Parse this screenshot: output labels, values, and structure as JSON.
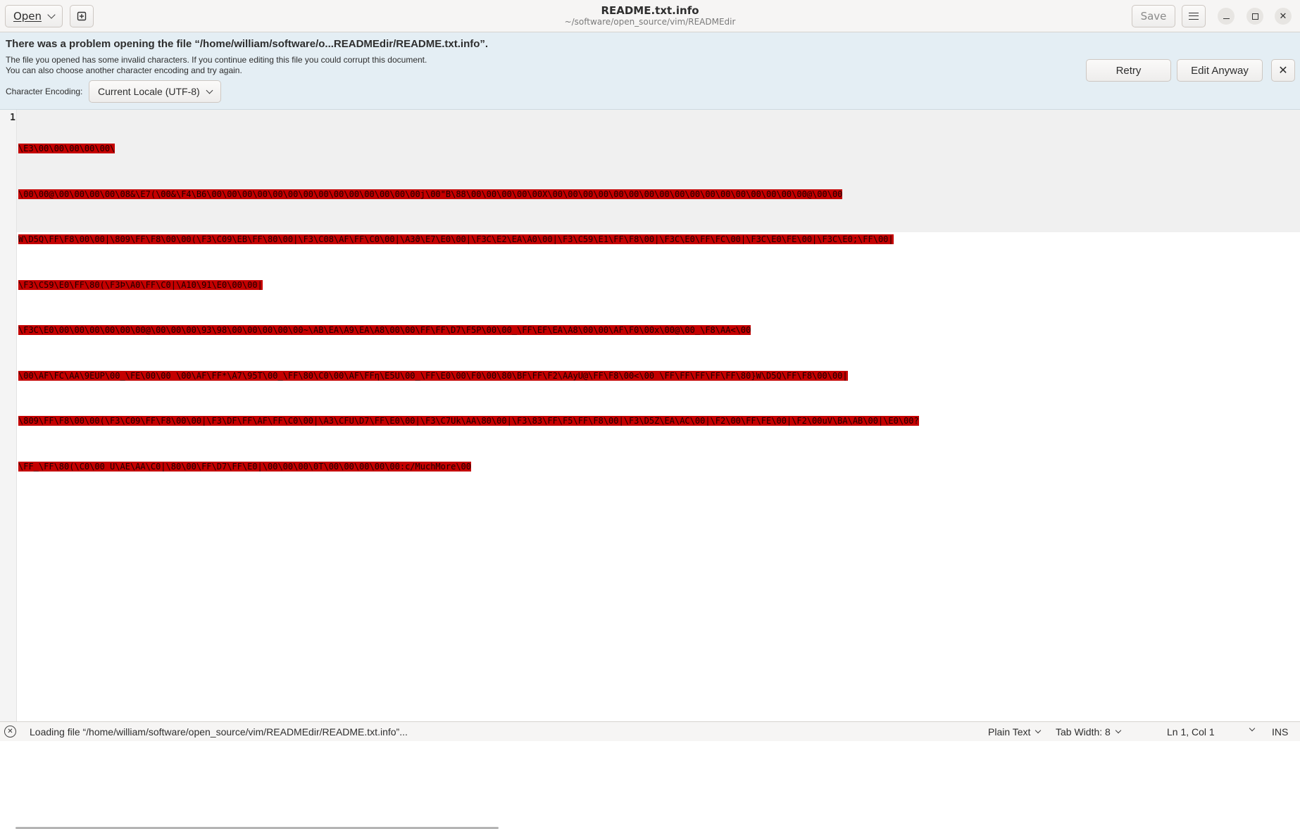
{
  "header": {
    "open_label": "Open",
    "title": "README.txt.info",
    "subtitle": "~/software/open_source/vim/READMEdir",
    "save_label": "Save"
  },
  "infobar": {
    "title": "There was a problem opening the file “/home/william/software/o...READMEdir/README.txt.info”.",
    "message_line1": "The file you opened has some invalid characters. If you continue editing this file you could corrupt this document.",
    "message_line2": "You can also choose another character encoding and try again.",
    "encoding_label": "Character Encoding:",
    "encoding_value": "Current Locale (UTF-8)",
    "retry_label": "Retry",
    "edit_anyway_label": "Edit Anyway",
    "close_glyph": "✕"
  },
  "editor": {
    "line_number": "1",
    "lines": [
      "\\E3\\00\\00\\00\\00\\00\\",
      "\\00\\00@\\00\\00\\00\\00\\08&\\E7(\\00&\\F4\\B6\\00\\00\\00\\00\\00\\00\\00\\00\\00\\00\\00\\00\\00\\00j\\00\"B\\88\\00\\00\\00\\00\\00X\\00\\00\\00\\00\\00\\00\\00\\00\\00\\00\\00\\00\\00\\00\\00\\00\\00@\\00\\00",
      "W\\D5Q\\FF\\F8\\00\\00|\\809\\FF\\F8\\00\\00(\\F3\\C09\\EB\\FF\\80\\00|\\F3\\C08\\AF\\FF\\C0\\00|\\A3ϑ\\E7\\E0\\00|\\F3Ϲ\\E2\\EA\\A0\\00|\\F3\\C59\\E1\\FF\\F8\\00|\\F3Ϲ\\E0\\FF\\FC\\00|\\F3Ϲ\\E0\\FE\\00|\\F3Ϲ\\E0;\\FF\\00|",
      "\\F3\\C59\\E0\\FF\\80(\\F3Ϸ\\A0\\FF\\C0|\\A10\\91\\E0\\00\\00|",
      "\\F3Ϲ\\E0\\00\\00\\00\\00\\00\\00@\\00\\00\\00\\93\\98\\00\\00\\00\\00\\00~\\AB\\EA\\A9\\EA\\A8\\00\\00\\FF\\FF\\D7\\F5P\\00\\00_\\FF\\EF\\EA\\A8\\00\\00\\AF\\F0\\00x\\00@\\00_\\F8\\AA<\\00",
      "\\00\\AF\\FC\\AA\\9EUP\\00_\\FE\\00\\00 \\00\\AF\\FF*\\A7\\95T\\00_\\FF\\80\\C0\\00\\AF\\FFƞ\\E5U\\00_\\FF\\E0\\00\\F0\\00\\80\\BF\\FF\\F2\\AAyU@\\FF\\F8\\00<\\00 \\FF\\FF\\FF\\FF\\FF\\80}W\\D5Q\\FF\\F8\\00\\00|",
      "\\809\\FF\\F8\\00\\00(\\F3\\C09\\FF\\F8\\00\\00|\\F3\\DF\\FF\\AF\\FF\\C0\\00|\\A3\\CFU\\D7\\FF\\E0\\00|\\F3\\C7Uk\\AA\\80\\00|\\F3\\83\\FF\\F5\\FF\\F8\\00|\\F3\\D5Z\\EA\\AC\\00|\\F2\\00\\FF\\FE\\00|\\F2\\00uV\\BA\\AB\\00|\\E0\\00?",
      "\\FF_\\FF\\80(\\C0\\00 U\\AE\\AA\\C0|\\80\\00\\FF\\D7\\FF\\E0|\\00\\00\\00\\0T\\00\\00\\00\\00\\00:c/MuchMore\\00"
    ]
  },
  "statusbar": {
    "message": "Loading file “/home/william/software/open_source/vim/READMEdir/README.txt.info”...",
    "language": "Plain Text",
    "tab_width": "Tab Width: 8",
    "position": "Ln 1, Col 1",
    "mode": "INS"
  }
}
